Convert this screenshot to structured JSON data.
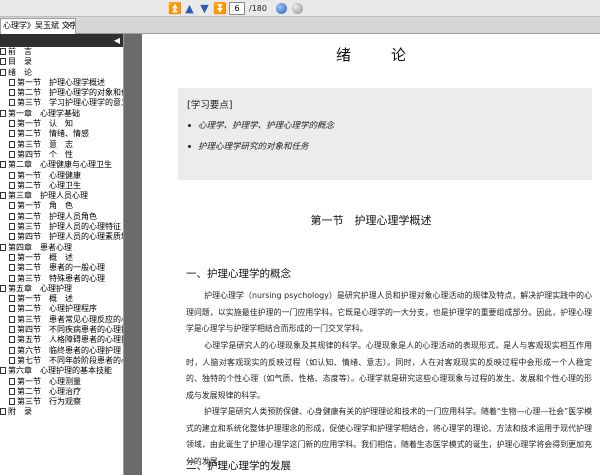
{
  "toolbar": {
    "page_current": "6",
    "page_total": "/180",
    "icons": [
      "first-page-icon",
      "prev-page-icon",
      "next-page-icon",
      "last-page-icon",
      "go-icon",
      "zoom-icon"
    ],
    "accent": "#2a5cb8"
  },
  "tab": {
    "label": "心理学》吴玉斌 文字版",
    "close": "×"
  },
  "sidebar": {
    "collapse": "◀",
    "items": [
      {
        "label": "前　言",
        "level": 0
      },
      {
        "label": "目　录",
        "level": 0
      },
      {
        "label": "绪　论",
        "level": 0
      },
      {
        "label": "第一节　护理心理学概述",
        "level": 1
      },
      {
        "label": "第二节　护理心理学的对象和任务",
        "level": 1
      },
      {
        "label": "第三节　学习护理心理学的意义",
        "level": 1
      },
      {
        "label": "第一章　心理学基础",
        "level": 0
      },
      {
        "label": "第一节　认　知",
        "level": 1
      },
      {
        "label": "第二节　情绪、情感",
        "level": 1
      },
      {
        "label": "第三节　意　志",
        "level": 1
      },
      {
        "label": "第四节　个　性",
        "level": 1
      },
      {
        "label": "第二章　心理健康与心理卫生",
        "level": 0
      },
      {
        "label": "第一节　心理健康",
        "level": 1
      },
      {
        "label": "第二节　心理卫生",
        "level": 1
      },
      {
        "label": "第三章　护理人员心理",
        "level": 0
      },
      {
        "label": "第一节　角　色",
        "level": 1
      },
      {
        "label": "第二节　护理人员角色",
        "level": 1
      },
      {
        "label": "第三节　护理人员的心理特征",
        "level": 1
      },
      {
        "label": "第四节　护理人员的心理素质培养",
        "level": 1
      },
      {
        "label": "第四章　患者心理",
        "level": 0
      },
      {
        "label": "第一节　概　述",
        "level": 1
      },
      {
        "label": "第二节　患者的一般心理",
        "level": 1
      },
      {
        "label": "第三节　特殊患者的心理",
        "level": 1
      },
      {
        "label": "第五章　心理护理",
        "level": 0
      },
      {
        "label": "第一节　概　述",
        "level": 1
      },
      {
        "label": "第二节　心理护理程序",
        "level": 1
      },
      {
        "label": "第三节　患者常见心理反应的心理护理",
        "level": 1
      },
      {
        "label": "第四节　不同疾病患者的心理护理",
        "level": 1
      },
      {
        "label": "第五节　人格障碍患者的心理护理",
        "level": 1
      },
      {
        "label": "第六节　临终患者的心理护理",
        "level": 1
      },
      {
        "label": "第七节　不同年龄阶段患者的心理护理",
        "level": 1
      },
      {
        "label": "第六章　心理护理的基本技能",
        "level": 0
      },
      {
        "label": "第一节　心理测量",
        "level": 1
      },
      {
        "label": "第二节　心理治疗",
        "level": 1
      },
      {
        "label": "第三节　行为观察",
        "level": 1
      },
      {
        "label": "附　录",
        "level": 0
      }
    ]
  },
  "page": {
    "title": "绪论",
    "key_points": {
      "heading": "[学习要点]",
      "items": [
        "心理学、护理学、护理心理学的概念",
        "护理心理学研究的对象和任务"
      ]
    },
    "section_title": "第一节　护理心理学概述",
    "h1": "一、护理心理学的概念",
    "p1": "护理心理学（nursing psychology）是研究护理人员和护理对象心理活动的规律及特点，解决护理实践中的心理问题，以实施最佳护理的一门应用学科。它既是心理学的一大分支，也是护理学的重要组成部分。因此，护理心理学是心理学与护理学相结合而形成的一门交叉学科。",
    "p2": "心理学是研究人的心理现象及其规律的科学。心理现象是人的心理活动的表现形式，是人与客观现实相互作用时，人脑对客观现实的反映过程（如认知、情绪、意志）。同时，人在对客观现实的反映过程中会形成一个人稳定的、独特的个性心理（如气质、性格、态度等）。心理学就是研究这些心理现象与过程的发生、发展和个性心理的形成与发展规律的科学。",
    "p3": "护理学是研究人类预防保健、心身健康有关的护理理论和技术的一门应用科学。随着“生物—心理—社会”医学模式的建立和系统化整体护理理念的形成，促使心理学和护理学相结合，将心理学的理论、方法和技术运用于现代护理领域，由此诞生了护理心理学这门新的应用学科。我们相信，随着生态医学模式的诞生，护理心理学将会得到更加充分的发展。",
    "h2": "二、护理心理学的发展"
  }
}
